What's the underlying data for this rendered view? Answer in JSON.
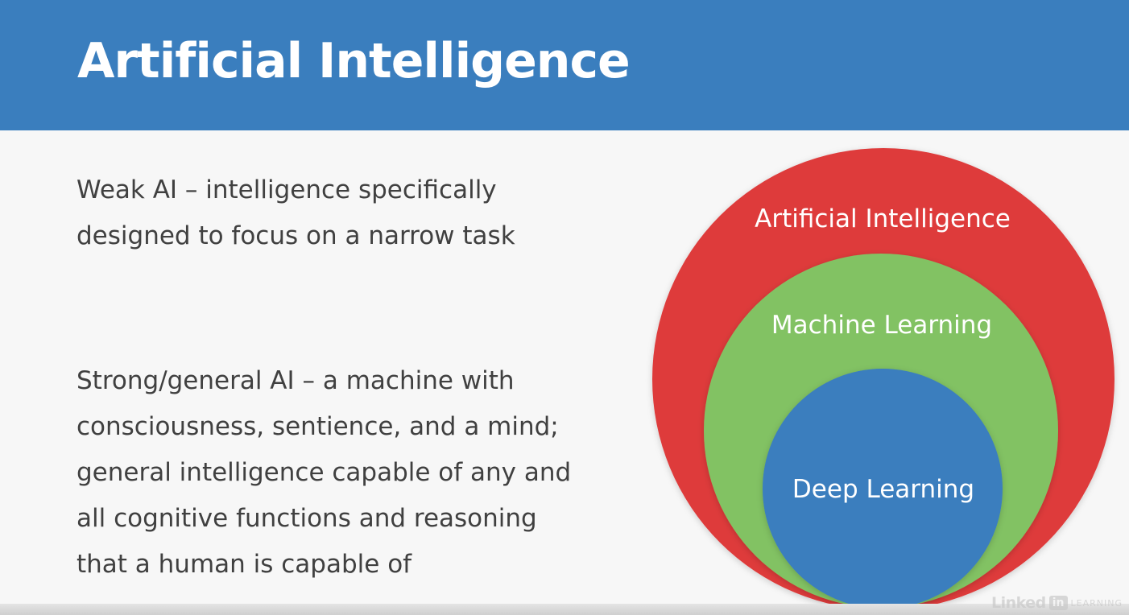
{
  "slide": {
    "title": "Artificial Intelligence",
    "weak_ai": {
      "lines": [
        "Weak AI – intelligence specifically",
        "designed to focus on a narrow task"
      ]
    },
    "strong_ai": {
      "lines": [
        "Strong/general AI – a machine with",
        "consciousness, sentience, and a mind;",
        "general intelligence capable of any and",
        "all cognitive functions and reasoning",
        "that a human is capable of"
      ]
    }
  },
  "diagram": {
    "outer_label": "Artificial Intelligence",
    "middle_label": "Machine Learning",
    "inner_label": "Deep Learning",
    "colors": {
      "outer": "#de3b3b",
      "middle": "#82c263",
      "inner": "#3a7ebe",
      "title_bar": "#3a7ebe",
      "body_text": "#404040"
    }
  },
  "watermark": {
    "brand": "Linked",
    "brand_box": "in",
    "product": "LEARNING"
  }
}
